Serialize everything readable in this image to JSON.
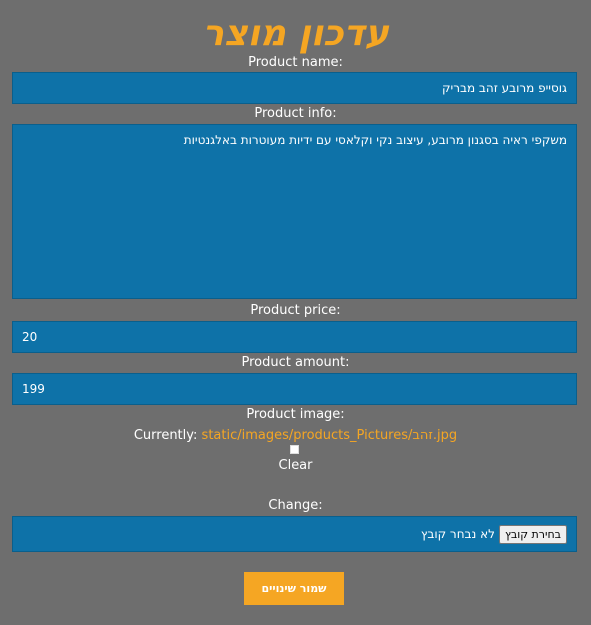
{
  "page": {
    "title": "עדכון מוצר"
  },
  "form": {
    "name_label": "Product name:",
    "name_value": "גוסייפ מרובע זהב מבריק",
    "info_label": "Product info:",
    "info_value": "משקפי ראיה בסגנון מרובע, עיצוב נקי וקלאסי עם ידיות מעוטרות באלגנטיות",
    "price_label": "Product price:",
    "price_value": "20",
    "amount_label": "Product amount:",
    "amount_value": "199",
    "image_label": "Product image:",
    "currently_label": "Currently:",
    "currently_link": "static/images/products_Pictures/זהב.jpg",
    "clear_label": "Clear",
    "change_label": "Change:",
    "file_button": "בחירת קובץ",
    "file_status": "לא נבחר קובץ",
    "save_button": "שמור שינויים"
  },
  "colors": {
    "background": "#6e6e6e",
    "field": "#0e72a8",
    "accent": "#f5a623"
  }
}
